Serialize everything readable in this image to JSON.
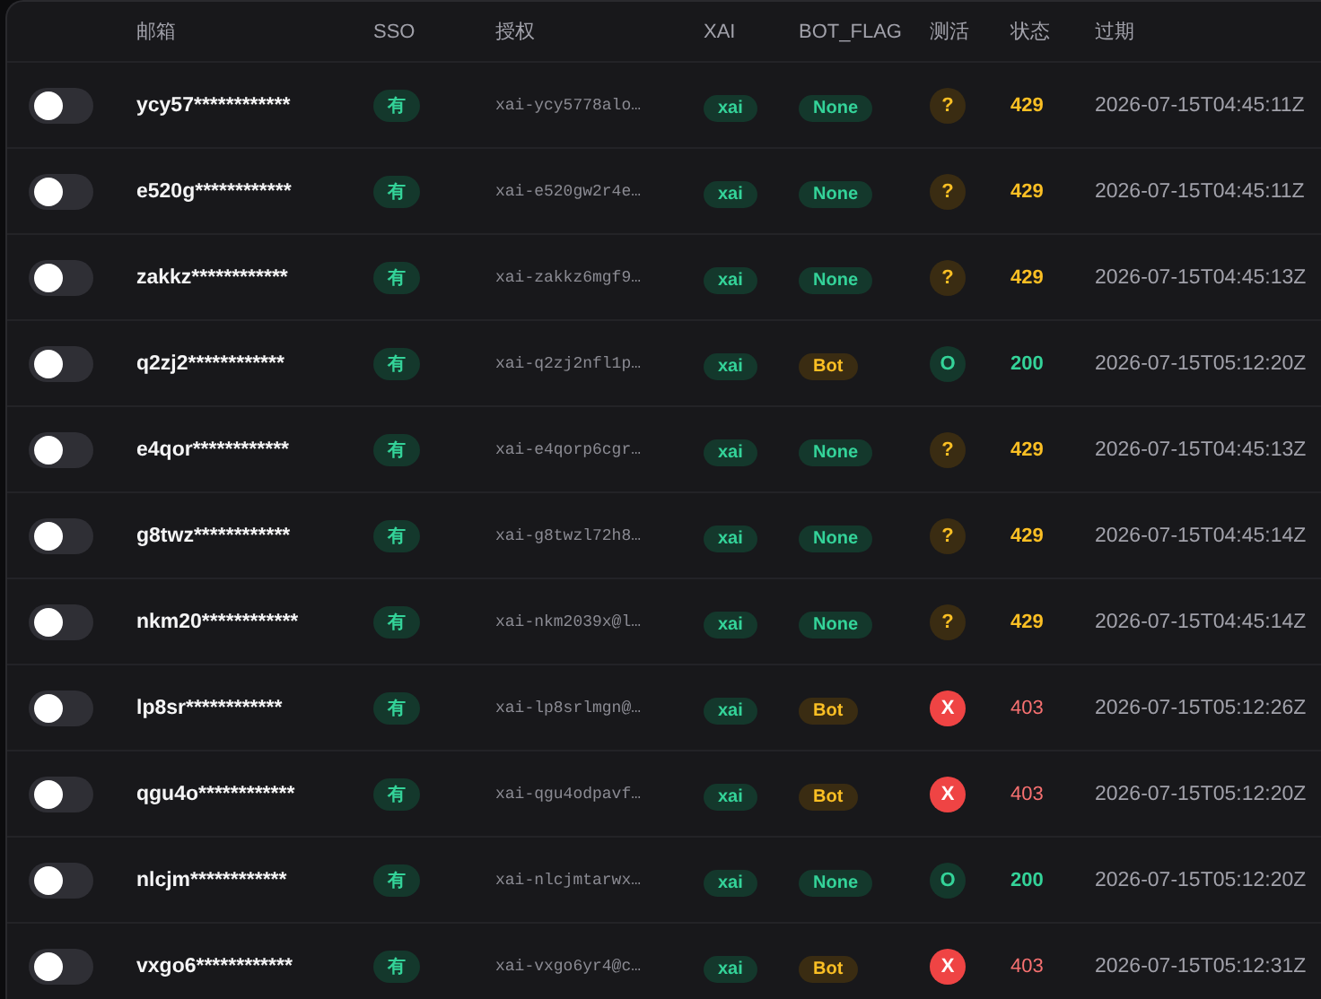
{
  "table": {
    "columns": [
      "邮箱",
      "SSO",
      "授权",
      "XAI",
      "BOT_FLAG",
      "测活",
      "状态",
      "过期"
    ],
    "rows": [
      {
        "on": false,
        "email": "ycy57************",
        "sso": "有",
        "auth": "xai-ycy5778alo…",
        "xai": "xai",
        "bot_flag": {
          "label": "None",
          "kind": "clear"
        },
        "test": {
          "symbol": "?",
          "kind": "warn"
        },
        "status": "429",
        "expires": "2026-07-15T04:45:11Z"
      },
      {
        "on": false,
        "email": "e520g************",
        "sso": "有",
        "auth": "xai-e520gw2r4e…",
        "xai": "xai",
        "bot_flag": {
          "label": "None",
          "kind": "clear"
        },
        "test": {
          "symbol": "?",
          "kind": "warn"
        },
        "status": "429",
        "expires": "2026-07-15T04:45:11Z"
      },
      {
        "on": false,
        "email": "zakkz************",
        "sso": "有",
        "auth": "xai-zakkz6mgf9…",
        "xai": "xai",
        "bot_flag": {
          "label": "None",
          "kind": "clear"
        },
        "test": {
          "symbol": "?",
          "kind": "warn"
        },
        "status": "429",
        "expires": "2026-07-15T04:45:13Z"
      },
      {
        "on": false,
        "email": "q2zj2************",
        "sso": "有",
        "auth": "xai-q2zj2nfl1p…",
        "xai": "xai",
        "bot_flag": {
          "label": "Bot",
          "kind": "bot"
        },
        "test": {
          "symbol": "O",
          "kind": "ok"
        },
        "status": "200",
        "expires": "2026-07-15T05:12:20Z"
      },
      {
        "on": false,
        "email": "e4qor************",
        "sso": "有",
        "auth": "xai-e4qorp6cgr…",
        "xai": "xai",
        "bot_flag": {
          "label": "None",
          "kind": "clear"
        },
        "test": {
          "symbol": "?",
          "kind": "warn"
        },
        "status": "429",
        "expires": "2026-07-15T04:45:13Z"
      },
      {
        "on": false,
        "email": "g8twz************",
        "sso": "有",
        "auth": "xai-g8twzl72h8…",
        "xai": "xai",
        "bot_flag": {
          "label": "None",
          "kind": "clear"
        },
        "test": {
          "symbol": "?",
          "kind": "warn"
        },
        "status": "429",
        "expires": "2026-07-15T04:45:14Z"
      },
      {
        "on": false,
        "email": "nkm20************",
        "sso": "有",
        "auth": "xai-nkm2039x@l…",
        "xai": "xai",
        "bot_flag": {
          "label": "None",
          "kind": "clear"
        },
        "test": {
          "symbol": "?",
          "kind": "warn"
        },
        "status": "429",
        "expires": "2026-07-15T04:45:14Z"
      },
      {
        "on": false,
        "email": "lp8sr************",
        "sso": "有",
        "auth": "xai-lp8srlmgn@…",
        "xai": "xai",
        "bot_flag": {
          "label": "Bot",
          "kind": "bot"
        },
        "test": {
          "symbol": "X",
          "kind": "fail"
        },
        "status": "403",
        "expires": "2026-07-15T05:12:26Z"
      },
      {
        "on": false,
        "email": "qgu4o************",
        "sso": "有",
        "auth": "xai-qgu4odpavf…",
        "xai": "xai",
        "bot_flag": {
          "label": "Bot",
          "kind": "bot"
        },
        "test": {
          "symbol": "X",
          "kind": "fail"
        },
        "status": "403",
        "expires": "2026-07-15T05:12:20Z"
      },
      {
        "on": false,
        "email": "nlcjm************",
        "sso": "有",
        "auth": "xai-nlcjmtarwx…",
        "xai": "xai",
        "bot_flag": {
          "label": "None",
          "kind": "clear"
        },
        "test": {
          "symbol": "O",
          "kind": "ok"
        },
        "status": "200",
        "expires": "2026-07-15T05:12:20Z"
      },
      {
        "on": false,
        "email": "vxgo6************",
        "sso": "有",
        "auth": "xai-vxgo6yr4@c…",
        "xai": "xai",
        "bot_flag": {
          "label": "Bot",
          "kind": "bot"
        },
        "test": {
          "symbol": "X",
          "kind": "fail"
        },
        "status": "403",
        "expires": "2026-07-15T05:12:31Z"
      }
    ]
  }
}
